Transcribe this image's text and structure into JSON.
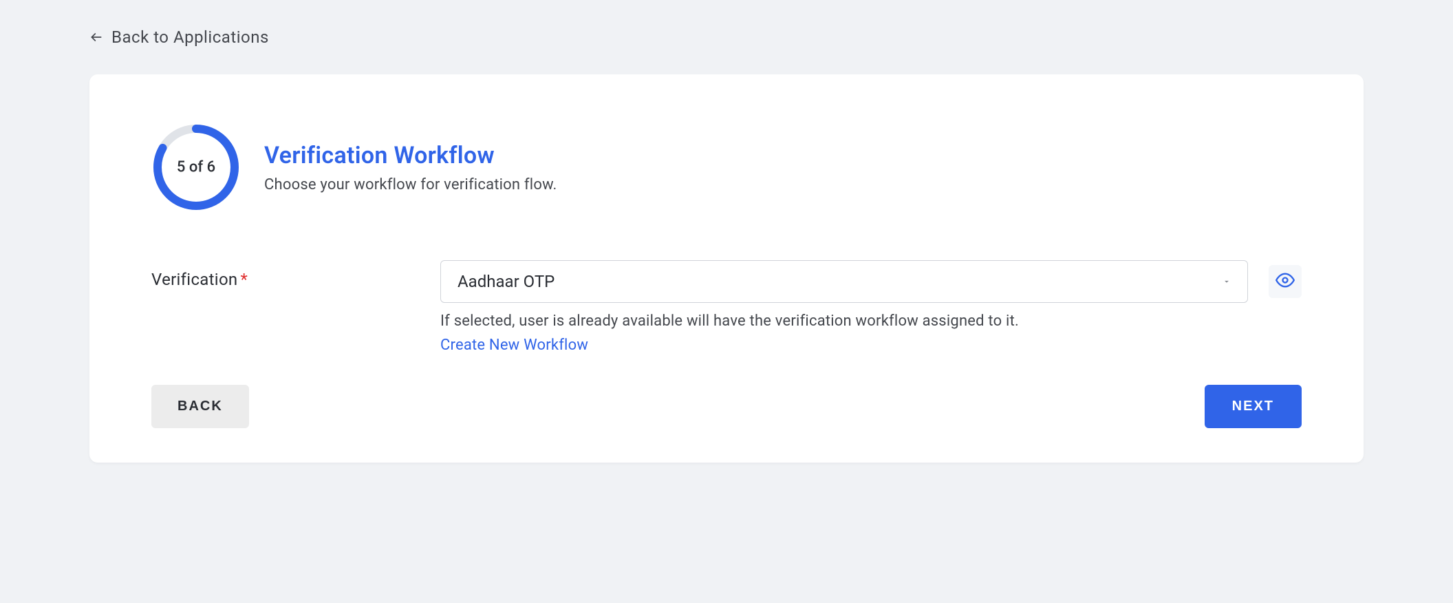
{
  "back_link": {
    "label": "Back to Applications"
  },
  "progress": {
    "current": 5,
    "total": 6,
    "text": "5 of 6"
  },
  "header": {
    "title": "Verification Workflow",
    "subtitle": "Choose your workflow for verification flow."
  },
  "form": {
    "label": "Verification",
    "required_mark": "*",
    "selected_option": "Aadhaar OTP",
    "helper_text": "If selected, user is already available will have the verification workflow assigned to it.",
    "create_link": "Create New Workflow"
  },
  "buttons": {
    "back": "BACK",
    "next": "NEXT"
  },
  "colors": {
    "accent": "#3064e8",
    "ring_track": "#e0e3e8"
  }
}
